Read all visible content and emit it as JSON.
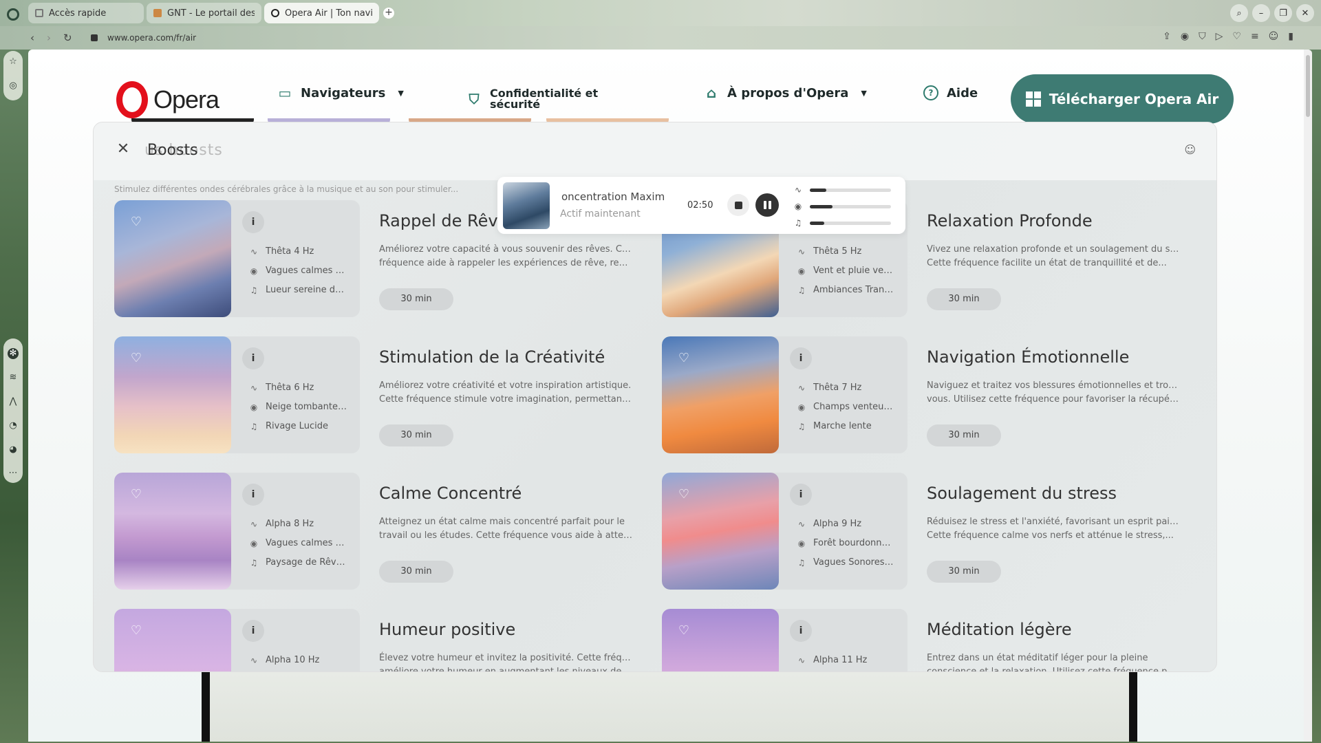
{
  "browser": {
    "tabs": [
      {
        "label": "Accès rapide"
      },
      {
        "label": "GNT - Le portail des nou"
      },
      {
        "label": "Opera Air | Ton navigate"
      }
    ],
    "url": "www.opera.com/fr/air"
  },
  "header": {
    "logo_text": "Opera",
    "nav": {
      "browsers": "Navigateurs",
      "privacy_line1": "Confidentialité et",
      "privacy_line2": "sécurité",
      "about": "À propos d'Opera",
      "help": "Aide"
    },
    "cta": "Télécharger Opera Air"
  },
  "panel": {
    "title": "Boosts",
    "ghost_title": "us boosts",
    "subtitle": "Stimulez différentes ondes cérébrales grâce à la musique et au son pour stimuler..."
  },
  "player": {
    "title": "oncentration Maxim",
    "status": "Actif maintenant",
    "time": "02:50",
    "levels": [
      0.2,
      0.28,
      0.18
    ]
  },
  "boosts": [
    {
      "title": "Rappel de Rêve",
      "freq": "Thêta 4 Hz",
      "sound": "Vagues calmes d...",
      "music": "Lueur sereine du ...",
      "desc": [
        "Améliorez votre capacité à vous souvenir des rêves. Cette",
        "fréquence aide à rappeler les expériences de rêve, rendan..."
      ],
      "duration": "30 min",
      "gradient": "linear-gradient(160deg,#7aa0d6 0%,#a8b6d8 35%,#c3a9b8 55%,#6d7fb0 75%,#3d4c7a 100%)"
    },
    {
      "title": "Relaxation Profonde",
      "freq": "Thêta 5 Hz",
      "sound": "Vent et pluie ver...",
      "music": "Ambiances Tranq...",
      "desc": [
        "Vivez une relaxation profonde et un soulagement du stress.",
        "Cette fréquence facilite un état de tranquillité et de..."
      ],
      "duration": "30 min",
      "gradient": "linear-gradient(160deg,#5f88c4 0%,#8fb0d6 35%,#f3d7b5 60%,#e0a77a 75%,#3e5f92 100%)"
    },
    {
      "title": "Stimulation de la Créativité",
      "freq": "Thêta 6 Hz",
      "sound": "Neige tombante ...",
      "music": "Rivage Lucide",
      "desc": [
        "Améliorez votre créativité et votre inspiration artistique.",
        "Cette fréquence stimule votre imagination, permettant à..."
      ],
      "duration": "30 min",
      "gradient": "linear-gradient(180deg,#8fb0e0 0%,#c2a6cc 35%,#e6c0c8 60%,#f2d6b6 85%,#f7e2c2 100%)"
    },
    {
      "title": "Navigation Émotionnelle",
      "freq": "Thêta 7 Hz",
      "sound": "Champs venteux ...",
      "music": "Marche lente",
      "desc": [
        "Naviguez et traitez vos blessures émotionnelles et trouvez-",
        "vous. Utilisez cette fréquence pour favoriser la récupérati..."
      ],
      "duration": "30 min",
      "gradient": "linear-gradient(170deg,#4a78b8 0%,#9aa9c8 30%,#f0a066 55%,#f08a40 75%,#c06a3a 100%)"
    },
    {
      "title": "Calme Concentré",
      "freq": "Alpha 8 Hz",
      "sound": "Vagues calmes d...",
      "music": "Paysage de Rêve ...",
      "desc": [
        "Atteignez un état calme mais concentré parfait pour le",
        "travail ou les études. Cette fréquence vous aide à atteindr..."
      ],
      "duration": "30 min",
      "gradient": "linear-gradient(180deg,#b8a6d8 0%,#d4b8e0 35%,#c39ad0 55%,#a884c4 75%,#e6d0ea 100%)"
    },
    {
      "title": "Soulagement du stress",
      "freq": "Alpha 9 Hz",
      "sound": "Forêt bourdonna...",
      "music": "Vagues Sonores ...",
      "desc": [
        "Réduisez le stress et l'anxiété, favorisant un esprit paisible.",
        "Cette fréquence calme vos nerfs et atténue le stress,..."
      ],
      "duration": "30 min",
      "gradient": "linear-gradient(170deg,#8fa8d8 0%,#e8a0a8 35%,#f08c8c 50%,#b8a0c8 70%,#6d86b8 100%)"
    },
    {
      "title": "Humeur positive",
      "freq": "Alpha 10 Hz",
      "sound": "",
      "music": "",
      "desc": [
        "Élevez votre humeur et invitez la positivité. Cette fréquence",
        "améliore votre humeur en augmentant les niveaux de..."
      ],
      "duration": "",
      "gradient": "linear-gradient(180deg,#c4a8e0 0%,#d8b4e4 50%,#e8a8c8 100%)"
    },
    {
      "title": "Méditation légère",
      "freq": "Alpha 11 Hz",
      "sound": "",
      "music": "",
      "desc": [
        "Entrez dans un état méditatif léger pour la pleine",
        "conscience et la relaxation. Utilisez cette fréquence pour..."
      ],
      "duration": "",
      "gradient": "linear-gradient(180deg,#a68cd4 0%,#d0a8dc 50%,#e8b8d4 100%)"
    }
  ]
}
